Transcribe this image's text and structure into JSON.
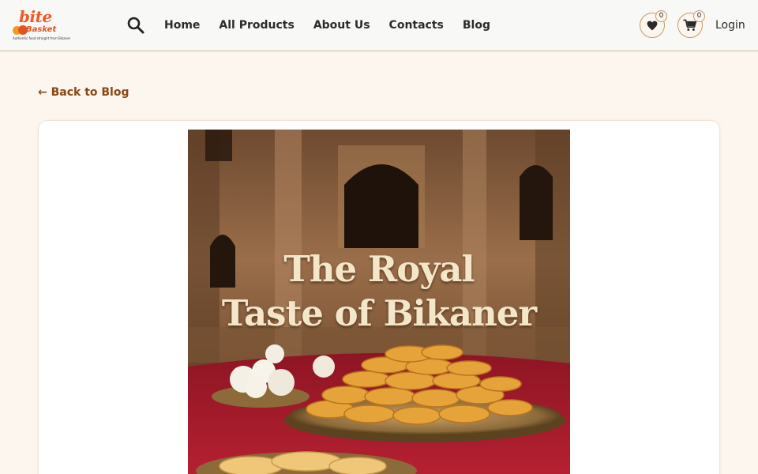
{
  "brand": {
    "name_top": "bite",
    "name_bottom": "Basket",
    "tagline": "Authentic food straight from Bikaner"
  },
  "header": {
    "search_icon": "search-icon",
    "nav": [
      {
        "label": "Home"
      },
      {
        "label": "All Products"
      },
      {
        "label": "About Us"
      },
      {
        "label": "Contacts"
      },
      {
        "label": "Blog"
      }
    ],
    "wishlist": {
      "icon": "heart-icon",
      "count": "0"
    },
    "cart": {
      "icon": "cart-icon",
      "count": "0"
    },
    "login_label": "Login"
  },
  "page": {
    "back_label": "← Back to Blog",
    "hero": {
      "title_line1": "The Royal",
      "title_line2": "Taste of Bikaner"
    }
  },
  "colors": {
    "page_bg": "#fdf6ee",
    "header_bg": "#f8f8f6",
    "accent_brown": "#8a4614",
    "brand_orange": "#ef5a24",
    "badge_border": "#c89a62"
  }
}
